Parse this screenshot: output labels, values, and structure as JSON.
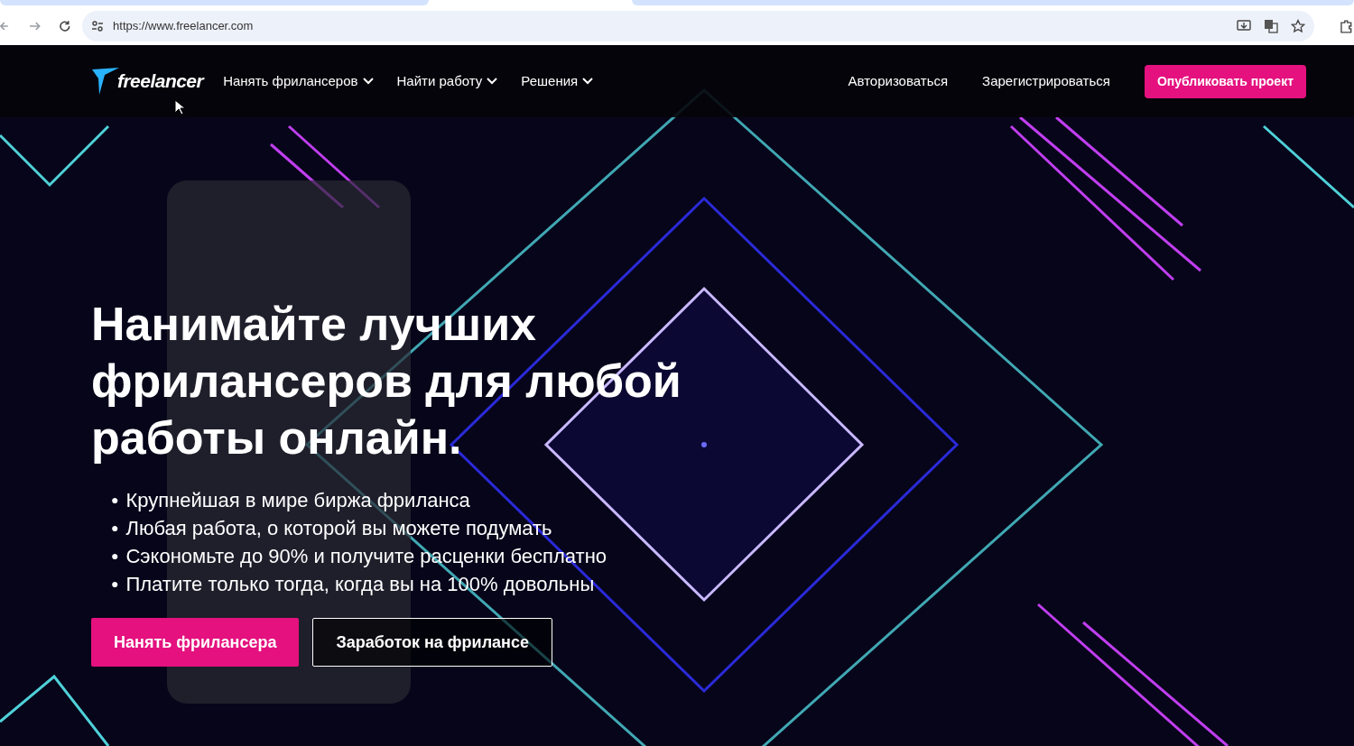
{
  "browser": {
    "url": "https://www.freelancer.com"
  },
  "nav": {
    "logo": "freelancer",
    "menus": [
      {
        "label": "Нанять фрилансеров"
      },
      {
        "label": "Найти работу"
      },
      {
        "label": "Решения"
      }
    ],
    "links": [
      "Авторизоваться",
      "Зарегистрироваться"
    ],
    "cta": "Опубликовать проект"
  },
  "hero": {
    "title": "Нанимайте лучших фрилансеров для любой работы онлайн.",
    "bullets": [
      {
        "marker": "●",
        "text": "Крупнейшая в мире биржа фриланса"
      },
      {
        "marker": "●",
        "text": "Любая работа, о которой вы можете подумать"
      },
      {
        "marker": "●",
        "text": "Сэкономьте до 90% и получите расценки бесплатно"
      },
      {
        "marker": "●",
        "text": "Платите только тогда, когда вы на 100% довольны"
      }
    ],
    "buttons": [
      {
        "label": "Нанять фрилансера",
        "kind": "primary"
      },
      {
        "label": "Заработок на фрилансе",
        "kind": "outline"
      }
    ]
  }
}
